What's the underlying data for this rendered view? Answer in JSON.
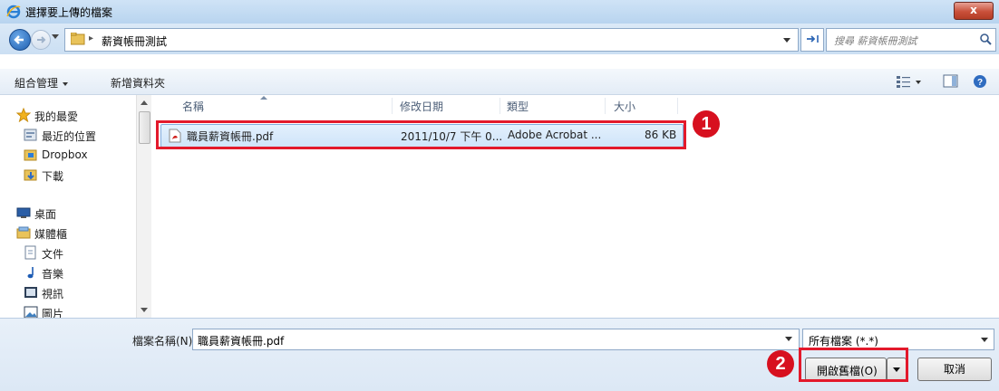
{
  "window": {
    "title": "選擇要上傳的檔案",
    "close_label": "x"
  },
  "address_bar": {
    "separator": "▸",
    "breadcrumb": "薪資帳冊測試",
    "refresh_glyph": "⁴⁄",
    "search_placeholder": "搜尋 薪資帳冊測試"
  },
  "command_bar": {
    "organize_label": "組合管理",
    "new_folder_label": "新增資料夾"
  },
  "nav_pane": {
    "items": [
      {
        "label": "我的最愛",
        "icon": "star-icon"
      },
      {
        "label": "最近的位置",
        "icon": "recent-places-icon"
      },
      {
        "label": "Dropbox",
        "icon": "dropbox-folder-icon"
      },
      {
        "label": "下載",
        "icon": "downloads-folder-icon"
      },
      {
        "label": "桌面",
        "icon": "desktop-icon"
      },
      {
        "label": "媒體櫃",
        "icon": "libraries-icon"
      },
      {
        "label": "文件",
        "icon": "documents-icon"
      },
      {
        "label": "音樂",
        "icon": "music-icon"
      },
      {
        "label": "視訊",
        "icon": "videos-icon"
      },
      {
        "label": "圖片",
        "icon": "pictures-icon"
      }
    ]
  },
  "file_list": {
    "columns": {
      "name": "名稱",
      "modified": "修改日期",
      "type": "類型",
      "size": "大小"
    },
    "rows": [
      {
        "name": "職員薪資帳冊.pdf",
        "modified": "2011/10/7 下午 0...",
        "type": "Adobe Acrobat ...",
        "size": "86 KB"
      }
    ]
  },
  "bottom": {
    "filename_label": "檔案名稱(N):",
    "filename_value": "職員薪資帳冊.pdf",
    "filter_value": "所有檔案 (*.*)",
    "open_label": "開啟舊檔(O)",
    "cancel_label": "取消"
  },
  "callouts": {
    "step1": "1",
    "step2": "2"
  },
  "colors": {
    "callout_red": "#e3192b",
    "selection_blue": "#cfe4fa"
  }
}
